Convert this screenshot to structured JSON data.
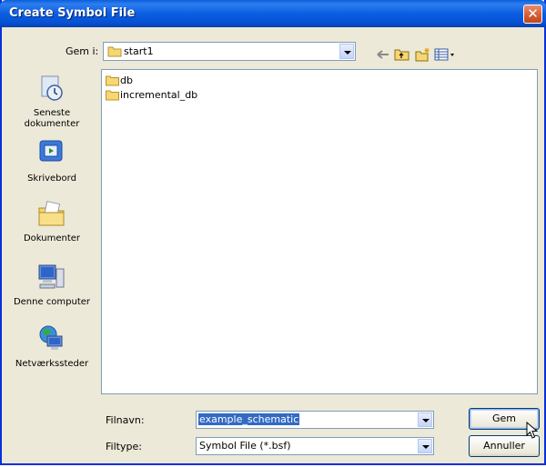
{
  "window": {
    "title": "Create Symbol File",
    "close_label": "✕"
  },
  "toolbar": {
    "save_in_label": "Gem i:",
    "save_in_value": "start1",
    "icons": [
      "back-icon",
      "up-folder-icon",
      "new-folder-icon",
      "view-menu-icon"
    ]
  },
  "places": [
    {
      "label": "Seneste dokumenter",
      "icon": "recent-documents-icon"
    },
    {
      "label": "Skrivebord",
      "icon": "desktop-icon"
    },
    {
      "label": "Dokumenter",
      "icon": "my-documents-icon"
    },
    {
      "label": "Denne computer",
      "icon": "my-computer-icon"
    },
    {
      "label": "Netværkssteder",
      "icon": "network-places-icon"
    }
  ],
  "files": [
    {
      "name": "db",
      "type": "folder"
    },
    {
      "name": "incremental_db",
      "type": "folder"
    }
  ],
  "form": {
    "filename_label": "Filnavn:",
    "filename_value": "example_schematic",
    "filetype_label": "Filtype:",
    "filetype_value": "Symbol File (*.bsf)"
  },
  "buttons": {
    "save": "Gem",
    "cancel": "Annuller"
  },
  "colors": {
    "title_bar": "#0b5ee1",
    "dialog_bg": "#ece9d8",
    "selection": "#316ac5"
  }
}
